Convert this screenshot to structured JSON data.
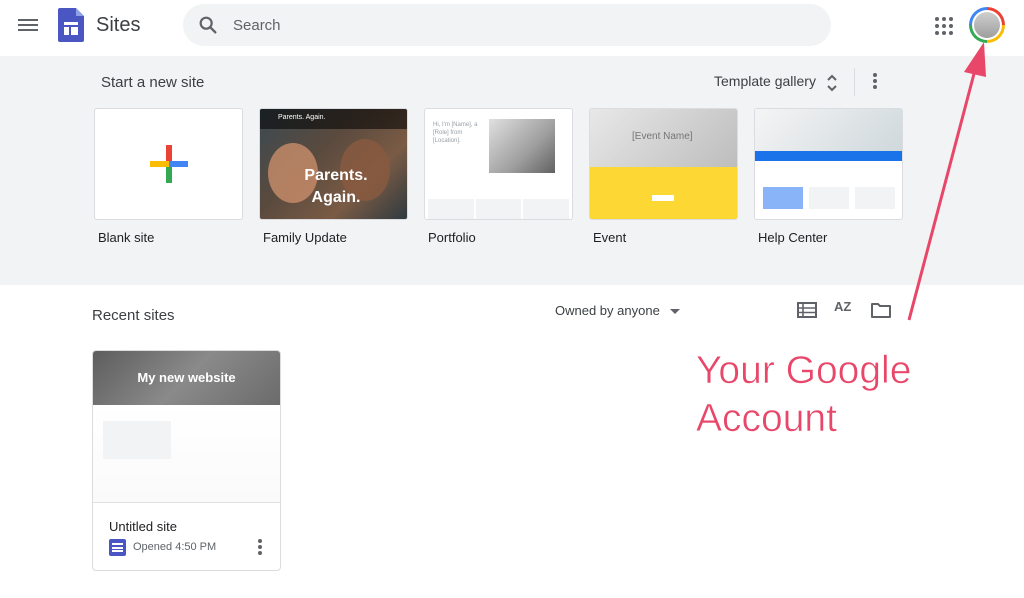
{
  "header": {
    "app_title": "Sites",
    "search_placeholder": "Search"
  },
  "new_site": {
    "title": "Start a new site",
    "template_gallery_label": "Template gallery",
    "templates": [
      {
        "label": "Blank site"
      },
      {
        "label": "Family Update",
        "banner": "Parents. Again.",
        "headline": "Parents. Again."
      },
      {
        "label": "Portfolio",
        "intro": "Hi, I'm [Name], a [Role] from [Location]."
      },
      {
        "label": "Event",
        "name_placeholder": "[Event Name]"
      },
      {
        "label": "Help Center"
      }
    ]
  },
  "recent": {
    "title": "Recent sites",
    "owner_filter": "Owned by anyone",
    "sort_label": "AZ",
    "sites": [
      {
        "thumb_title": "My new website",
        "name": "Untitled site",
        "opened": "Opened 4:50 PM"
      }
    ]
  },
  "annotation": {
    "line1": "Your Google",
    "line2": "Account",
    "color": "#e8476a"
  },
  "colors": {
    "background_section": "#f1f3f4",
    "brand_blue": "#4a57c2"
  },
  "icons": [
    "menu-icon",
    "sites-logo-icon",
    "search-icon",
    "apps-grid-icon",
    "avatar",
    "unfold-icon",
    "more-vert-icon",
    "list-view-icon",
    "sort-az-icon",
    "folder-icon",
    "site-icon"
  ]
}
